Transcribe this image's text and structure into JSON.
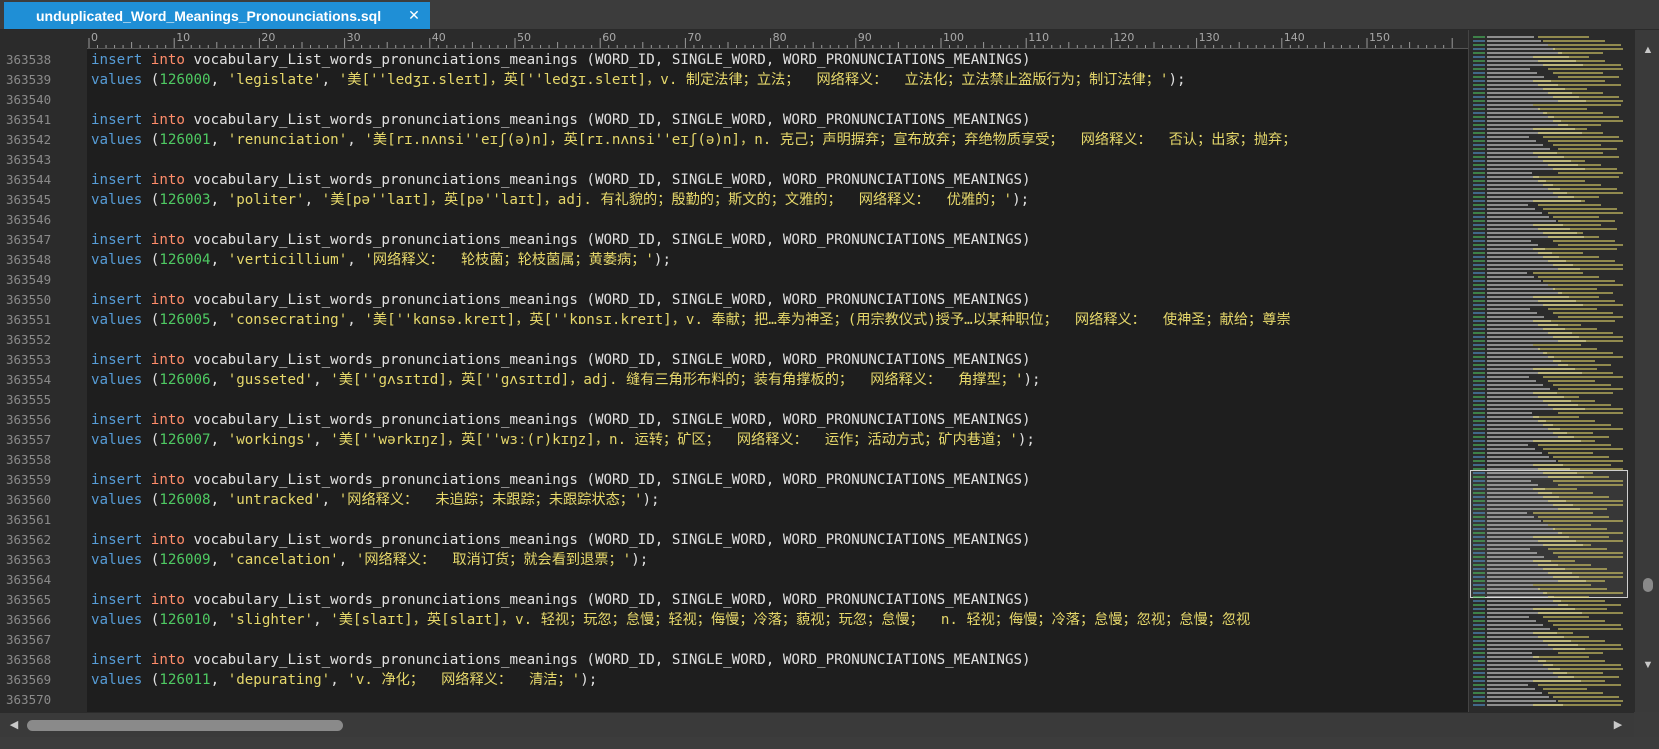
{
  "tab": {
    "title": "unduplicated_Word_Meanings_Pronounciations.sql",
    "close_glyph": "✕"
  },
  "ruler": {
    "marks": [
      "0",
      "10",
      "20",
      "30",
      "40",
      "50",
      "60",
      "70",
      "80",
      "90",
      "100",
      "110",
      "120",
      "130",
      "140",
      "150"
    ]
  },
  "colors": {
    "keyword_insert": "#569cd6",
    "keyword_into": "#ff8c6a",
    "number": "#4ec962",
    "string": "#e6d86b",
    "text": "#e0e0e0",
    "tab_active": "#1f8fd6"
  },
  "lines": [
    {
      "n": "363538",
      "parts": [
        [
          "kw1",
          "insert"
        ],
        [
          "txt",
          " "
        ],
        [
          "kw2",
          "into"
        ],
        [
          "txt",
          " vocabulary_List_words_pronunciations_meanings (WORD_ID, SINGLE_WORD, WORD_PRONUNCIATIONS_MEANINGS)"
        ]
      ]
    },
    {
      "n": "363539",
      "parts": [
        [
          "kw1",
          "values"
        ],
        [
          "txt",
          " ("
        ],
        [
          "num",
          "126000"
        ],
        [
          "txt",
          ", "
        ],
        [
          "str",
          "'legislate'"
        ],
        [
          "txt",
          ", "
        ],
        [
          "str",
          "'美[''ledʒɪ.sleɪt]，英[''ledʒɪ.sleɪt]，v. 制定法律；立法；  网络释义：  立法化；立法禁止盗版行为；制订法律；'"
        ],
        [
          "txt",
          ");"
        ]
      ]
    },
    {
      "n": "363540",
      "parts": []
    },
    {
      "n": "363541",
      "parts": [
        [
          "kw1",
          "insert"
        ],
        [
          "txt",
          " "
        ],
        [
          "kw2",
          "into"
        ],
        [
          "txt",
          " vocabulary_List_words_pronunciations_meanings (WORD_ID, SINGLE_WORD, WORD_PRONUNCIATIONS_MEANINGS)"
        ]
      ]
    },
    {
      "n": "363542",
      "parts": [
        [
          "kw1",
          "values"
        ],
        [
          "txt",
          " ("
        ],
        [
          "num",
          "126001"
        ],
        [
          "txt",
          ", "
        ],
        [
          "str",
          "'renunciation'"
        ],
        [
          "txt",
          ", "
        ],
        [
          "str",
          "'美[rɪ.nʌnsi''eɪʃ(ə)n]，英[rɪ.nʌnsi''eɪʃ(ə)n]，n. 克己；声明摒弃；宣布放弃；弃绝物质享受；  网络释义：  否认；出家；抛弃；"
        ]
      ]
    },
    {
      "n": "363543",
      "parts": []
    },
    {
      "n": "363544",
      "parts": [
        [
          "kw1",
          "insert"
        ],
        [
          "txt",
          " "
        ],
        [
          "kw2",
          "into"
        ],
        [
          "txt",
          " vocabulary_List_words_pronunciations_meanings (WORD_ID, SINGLE_WORD, WORD_PRONUNCIATIONS_MEANINGS)"
        ]
      ]
    },
    {
      "n": "363545",
      "parts": [
        [
          "kw1",
          "values"
        ],
        [
          "txt",
          " ("
        ],
        [
          "num",
          "126003"
        ],
        [
          "txt",
          ", "
        ],
        [
          "str",
          "'politer'"
        ],
        [
          "txt",
          ", "
        ],
        [
          "str",
          "'美[pə''laɪt]，英[pə''laɪt]，adj. 有礼貌的；殷勤的；斯文的；文雅的；  网络释义：  优雅的；'"
        ],
        [
          "txt",
          ");"
        ]
      ]
    },
    {
      "n": "363546",
      "parts": []
    },
    {
      "n": "363547",
      "parts": [
        [
          "kw1",
          "insert"
        ],
        [
          "txt",
          " "
        ],
        [
          "kw2",
          "into"
        ],
        [
          "txt",
          " vocabulary_List_words_pronunciations_meanings (WORD_ID, SINGLE_WORD, WORD_PRONUNCIATIONS_MEANINGS)"
        ]
      ]
    },
    {
      "n": "363548",
      "parts": [
        [
          "kw1",
          "values"
        ],
        [
          "txt",
          " ("
        ],
        [
          "num",
          "126004"
        ],
        [
          "txt",
          ", "
        ],
        [
          "str",
          "'verticillium'"
        ],
        [
          "txt",
          ", "
        ],
        [
          "str",
          "'网络释义：  轮枝菌；轮枝菌属；黄萎病；'"
        ],
        [
          "txt",
          ");"
        ]
      ]
    },
    {
      "n": "363549",
      "parts": []
    },
    {
      "n": "363550",
      "parts": [
        [
          "kw1",
          "insert"
        ],
        [
          "txt",
          " "
        ],
        [
          "kw2",
          "into"
        ],
        [
          "txt",
          " vocabulary_List_words_pronunciations_meanings (WORD_ID, SINGLE_WORD, WORD_PRONUNCIATIONS_MEANINGS)"
        ]
      ]
    },
    {
      "n": "363551",
      "parts": [
        [
          "kw1",
          "values"
        ],
        [
          "txt",
          " ("
        ],
        [
          "num",
          "126005"
        ],
        [
          "txt",
          ", "
        ],
        [
          "str",
          "'consecrating'"
        ],
        [
          "txt",
          ", "
        ],
        [
          "str",
          "'美[''kɑnsə.kreɪt]，英[''kɒnsɪ.kreɪt]，v. 奉献；把…奉为神圣；(用宗教仪式)授予…以某种职位；  网络释义：  使神圣；献给；尊崇"
        ]
      ]
    },
    {
      "n": "363552",
      "parts": []
    },
    {
      "n": "363553",
      "parts": [
        [
          "kw1",
          "insert"
        ],
        [
          "txt",
          " "
        ],
        [
          "kw2",
          "into"
        ],
        [
          "txt",
          " vocabulary_List_words_pronunciations_meanings (WORD_ID, SINGLE_WORD, WORD_PRONUNCIATIONS_MEANINGS)"
        ]
      ]
    },
    {
      "n": "363554",
      "parts": [
        [
          "kw1",
          "values"
        ],
        [
          "txt",
          " ("
        ],
        [
          "num",
          "126006"
        ],
        [
          "txt",
          ", "
        ],
        [
          "str",
          "'gusseted'"
        ],
        [
          "txt",
          ", "
        ],
        [
          "str",
          "'美[''gʌsɪtɪd]，英[''gʌsɪtɪd]，adj. 缝有三角形布料的；装有角撑板的；  网络释义：  角撑型；'"
        ],
        [
          "txt",
          ");"
        ]
      ]
    },
    {
      "n": "363555",
      "parts": []
    },
    {
      "n": "363556",
      "parts": [
        [
          "kw1",
          "insert"
        ],
        [
          "txt",
          " "
        ],
        [
          "kw2",
          "into"
        ],
        [
          "txt",
          " vocabulary_List_words_pronunciations_meanings (WORD_ID, SINGLE_WORD, WORD_PRONUNCIATIONS_MEANINGS)"
        ]
      ]
    },
    {
      "n": "363557",
      "parts": [
        [
          "kw1",
          "values"
        ],
        [
          "txt",
          " ("
        ],
        [
          "num",
          "126007"
        ],
        [
          "txt",
          ", "
        ],
        [
          "str",
          "'workings'"
        ],
        [
          "txt",
          ", "
        ],
        [
          "str",
          "'美[''wərkɪŋz]，英[''wɜː(r)kɪŋz]，n. 运转；矿区；  网络释义：  运作；活动方式；矿内巷道；'"
        ],
        [
          "txt",
          ");"
        ]
      ]
    },
    {
      "n": "363558",
      "parts": []
    },
    {
      "n": "363559",
      "parts": [
        [
          "kw1",
          "insert"
        ],
        [
          "txt",
          " "
        ],
        [
          "kw2",
          "into"
        ],
        [
          "txt",
          " vocabulary_List_words_pronunciations_meanings (WORD_ID, SINGLE_WORD, WORD_PRONUNCIATIONS_MEANINGS)"
        ]
      ]
    },
    {
      "n": "363560",
      "parts": [
        [
          "kw1",
          "values"
        ],
        [
          "txt",
          " ("
        ],
        [
          "num",
          "126008"
        ],
        [
          "txt",
          ", "
        ],
        [
          "str",
          "'untracked'"
        ],
        [
          "txt",
          ", "
        ],
        [
          "str",
          "'网络释义：  未追踪；未跟踪；未跟踪状态；'"
        ],
        [
          "txt",
          ");"
        ]
      ]
    },
    {
      "n": "363561",
      "parts": []
    },
    {
      "n": "363562",
      "parts": [
        [
          "kw1",
          "insert"
        ],
        [
          "txt",
          " "
        ],
        [
          "kw2",
          "into"
        ],
        [
          "txt",
          " vocabulary_List_words_pronunciations_meanings (WORD_ID, SINGLE_WORD, WORD_PRONUNCIATIONS_MEANINGS)"
        ]
      ]
    },
    {
      "n": "363563",
      "parts": [
        [
          "kw1",
          "values"
        ],
        [
          "txt",
          " ("
        ],
        [
          "num",
          "126009"
        ],
        [
          "txt",
          ", "
        ],
        [
          "str",
          "'cancelation'"
        ],
        [
          "txt",
          ", "
        ],
        [
          "str",
          "'网络释义：  取消订货；就会看到退票；'"
        ],
        [
          "txt",
          ");"
        ]
      ]
    },
    {
      "n": "363564",
      "parts": []
    },
    {
      "n": "363565",
      "parts": [
        [
          "kw1",
          "insert"
        ],
        [
          "txt",
          " "
        ],
        [
          "kw2",
          "into"
        ],
        [
          "txt",
          " vocabulary_List_words_pronunciations_meanings (WORD_ID, SINGLE_WORD, WORD_PRONUNCIATIONS_MEANINGS)"
        ]
      ]
    },
    {
      "n": "363566",
      "parts": [
        [
          "kw1",
          "values"
        ],
        [
          "txt",
          " ("
        ],
        [
          "num",
          "126010"
        ],
        [
          "txt",
          ", "
        ],
        [
          "str",
          "'slighter'"
        ],
        [
          "txt",
          ", "
        ],
        [
          "str",
          "'美[slaɪt]，英[slaɪt]，v. 轻视；玩忽；怠慢；轻视；侮慢；冷落；藐视；玩忽；怠慢；  n. 轻视；侮慢；冷落；怠慢；忽视；怠慢；忽视"
        ]
      ]
    },
    {
      "n": "363567",
      "parts": []
    },
    {
      "n": "363568",
      "parts": [
        [
          "kw1",
          "insert"
        ],
        [
          "txt",
          " "
        ],
        [
          "kw2",
          "into"
        ],
        [
          "txt",
          " vocabulary_List_words_pronunciations_meanings (WORD_ID, SINGLE_WORD, WORD_PRONUNCIATIONS_MEANINGS)"
        ]
      ]
    },
    {
      "n": "363569",
      "parts": [
        [
          "kw1",
          "values"
        ],
        [
          "txt",
          " ("
        ],
        [
          "num",
          "126011"
        ],
        [
          "txt",
          ", "
        ],
        [
          "str",
          "'depurating'"
        ],
        [
          "txt",
          ", "
        ],
        [
          "str",
          "'v. 净化；  网络释义：  清洁；'"
        ],
        [
          "txt",
          ");"
        ]
      ]
    },
    {
      "n": "363570",
      "parts": []
    }
  ],
  "scrollbar_icons": {
    "up": "chevron-up-icon",
    "down": "chevron-down-icon",
    "left": "chevron-left-icon",
    "right": "chevron-right-icon"
  }
}
